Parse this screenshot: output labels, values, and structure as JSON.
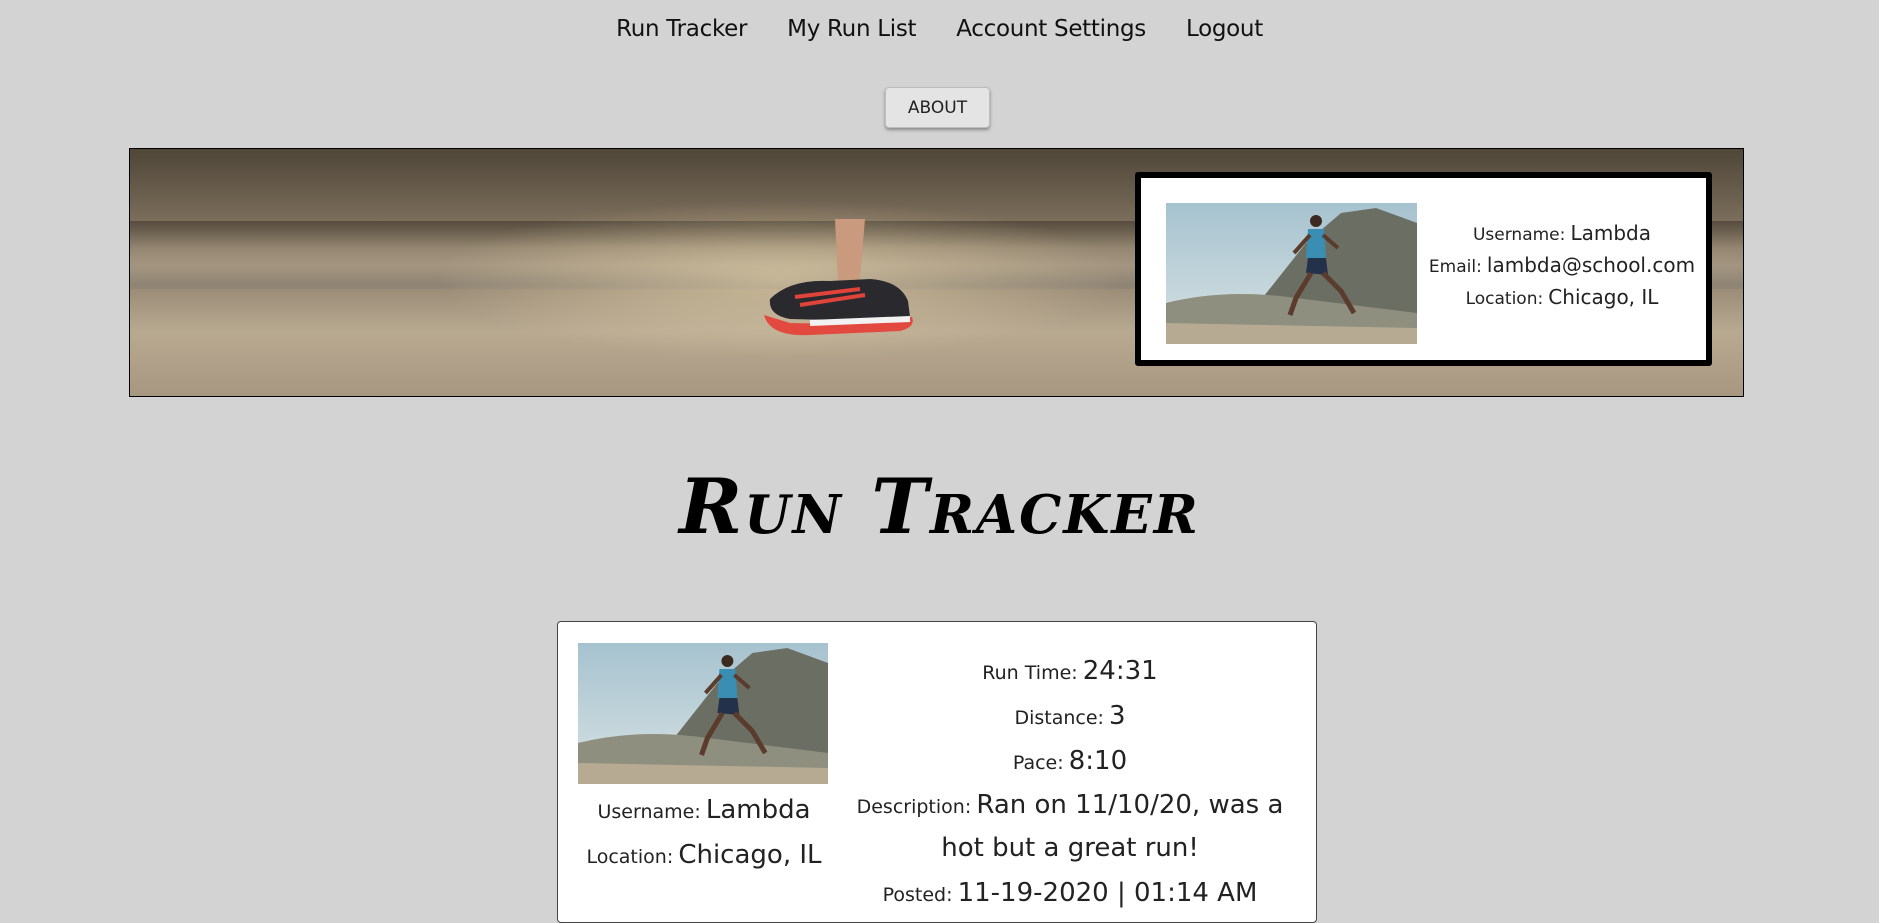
{
  "nav": {
    "items": [
      "Run Tracker",
      "My Run List",
      "Account Settings",
      "Logout"
    ]
  },
  "about_button": "ABOUT",
  "profile": {
    "username_label": "Username:",
    "username": "Lambda",
    "email_label": "Email:",
    "email": "lambda@school.com",
    "location_label": "Location:",
    "location": "Chicago, IL"
  },
  "page_title": "Run Tracker",
  "run": {
    "username_label": "Username:",
    "username": "Lambda",
    "location_label": "Location:",
    "location": "Chicago, IL",
    "run_time_label": "Run Time:",
    "run_time": "24:31",
    "distance_label": "Distance:",
    "distance": "3",
    "pace_label": "Pace:",
    "pace": "8:10",
    "description_label": "Description:",
    "description": "Ran on 11/10/20, was a hot but a great run!",
    "posted_label": "Posted:",
    "posted": "11-19-2020 | 01:14 AM"
  },
  "colors": {
    "page_background": "#d3d3d3",
    "card_background": "#ffffff",
    "card_border": "#000000"
  },
  "icons": {
    "hero_image": "running-shoe-photo",
    "profile_image": "runner-photo"
  }
}
